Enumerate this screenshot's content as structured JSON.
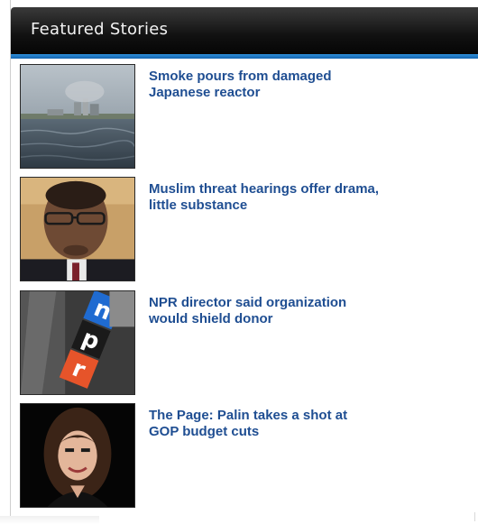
{
  "widget": {
    "title": "Featured Stories",
    "accent_color": "#1c74c4",
    "headline_color": "#1f4e92"
  },
  "stories": [
    {
      "headline_line1": "Smoke pours from damaged",
      "headline_line2": "Japanese reactor",
      "thumbnail": "reactor-photo"
    },
    {
      "headline_line1": "Muslim threat hearings offer drama,",
      "headline_line2": "little substance",
      "thumbnail": "congressman-photo"
    },
    {
      "headline_line1": "NPR director said organization",
      "headline_line2": "would shield donor",
      "thumbnail": "npr-microphone-photo"
    },
    {
      "headline_line1": "The Page: Palin takes a shot at",
      "headline_line2": "GOP budget cuts",
      "thumbnail": "palin-photo"
    }
  ]
}
